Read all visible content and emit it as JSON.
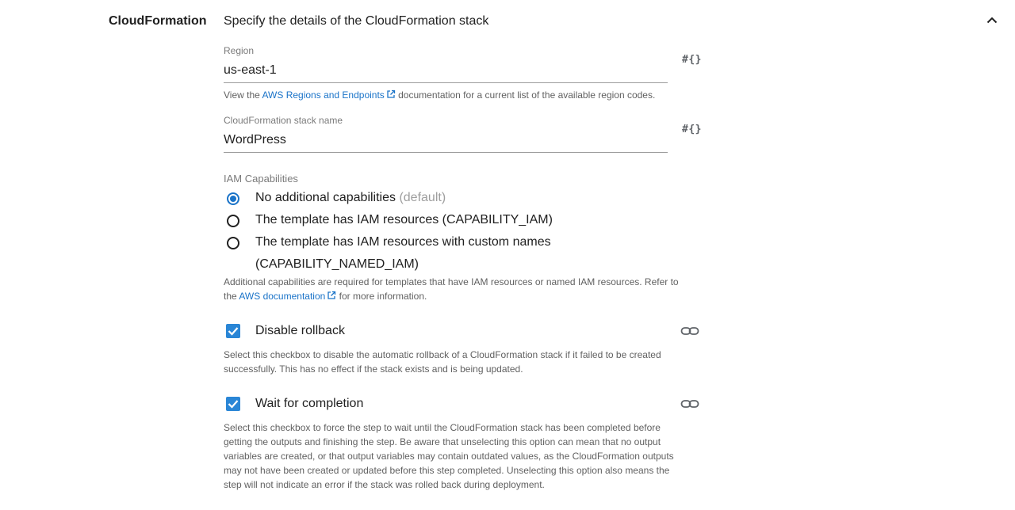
{
  "section": {
    "title": "CloudFormation",
    "description": "Specify the details of the CloudFormation stack",
    "collapse_icon": "chevron-up-icon"
  },
  "region": {
    "label": "Region",
    "value": "us-east-1",
    "variable_button": "#{}",
    "help_prefix": "View the ",
    "help_link": "AWS Regions and Endpoints",
    "help_suffix": " documentation for a current list of the available region codes."
  },
  "stack_name": {
    "label": "CloudFormation stack name",
    "value": "WordPress",
    "variable_button": "#{}"
  },
  "iam": {
    "label": "IAM Capabilities",
    "options": [
      {
        "label": "No additional capabilities",
        "suffix": "(default)",
        "checked": true
      },
      {
        "label": "The template has IAM resources (CAPABILITY_IAM)",
        "checked": false
      },
      {
        "label_line1": "The template has IAM resources with custom names",
        "label_line2": "(CAPABILITY_NAMED_IAM)",
        "checked": false
      }
    ],
    "help_line1": "Additional capabilities are required for templates that have IAM resources or named IAM resources. Refer to",
    "help_prefix": "the ",
    "help_link": "AWS documentation",
    "help_suffix": " for more information."
  },
  "disable_rollback": {
    "label": "Disable rollback",
    "checked": true,
    "help_line1": "Select this checkbox to disable the automatic rollback of a CloudFormation stack if it failed to be created",
    "help_line2": "successfully. This has no effect if the stack exists and is being updated."
  },
  "wait_for_completion": {
    "label": "Wait for completion",
    "checked": true,
    "help_line1": "Select this checkbox to force the step to wait until the CloudFormation stack has been completed before",
    "help_line2": "getting the outputs and finishing the step. Be aware that unselecting this option can mean that no output",
    "help_line3": "variables are created, or that output variables may contain outdated values, as the CloudFormation outputs",
    "help_line4": "may not have been created or updated before this step completed. Unselecting this option also means the",
    "help_line5": "step will not indicate an error if the stack was rolled back during deployment."
  },
  "colors": {
    "accent": "#1a73c8",
    "checkbox": "#2a86d6",
    "help_text": "#616161"
  }
}
